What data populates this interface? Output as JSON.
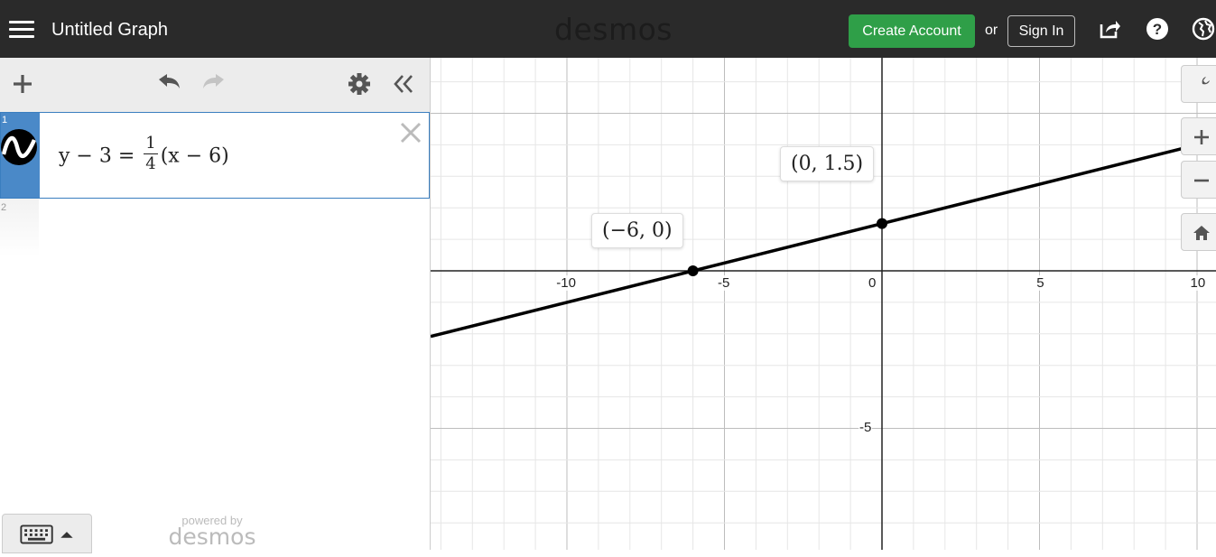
{
  "header": {
    "title": "Untitled Graph",
    "logo": "desmos",
    "create_account": "Create Account",
    "or": "or",
    "sign_in": "Sign In",
    "icons": [
      "menu-icon",
      "share-icon",
      "help-icon",
      "globe-icon"
    ],
    "background": "#2a2a2a",
    "accent": "#2f9f48"
  },
  "expressions": [
    {
      "index": "1",
      "latex_parts": {
        "lhs": "y − 3 = ",
        "num": "1",
        "den": "4",
        "rhs": "(x − 6)"
      },
      "icon": "wave-icon",
      "color": "#000000"
    },
    {
      "index": "2",
      "latex_parts": null
    }
  ],
  "footer": {
    "powered_by": "powered by",
    "brand": "desmos"
  },
  "graph": {
    "x_ticks": [
      "-10",
      "-5",
      "0",
      "5",
      "10"
    ],
    "y_ticks": [
      "-5"
    ],
    "points": [
      {
        "label": "(−6, 0)",
        "x": -6,
        "y": 0
      },
      {
        "label": "(0, 1.5)",
        "x": 0,
        "y": 1.5
      }
    ],
    "line": {
      "slope": 0.25,
      "intercept": 1.5,
      "color": "#000000"
    }
  }
}
